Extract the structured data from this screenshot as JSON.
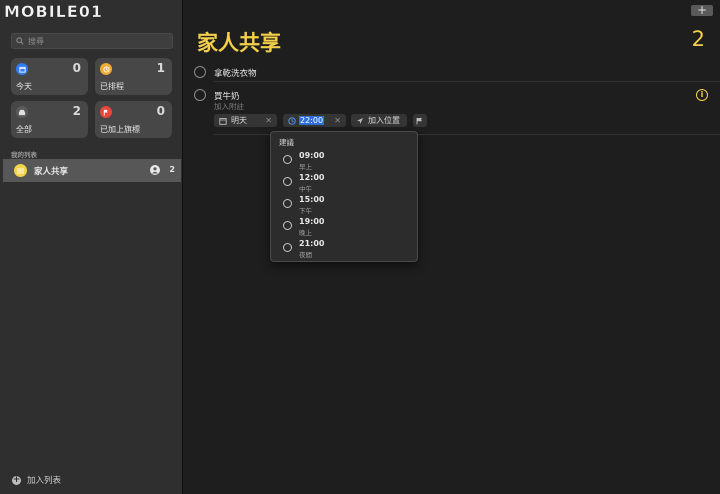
{
  "logo": "MOBILE01",
  "sidebar": {
    "search_placeholder": "搜尋",
    "tiles": [
      {
        "label": "今天",
        "count": "0",
        "color": "#2f7cf6",
        "icon": "calendar-icon"
      },
      {
        "label": "已排程",
        "count": "1",
        "color": "#f0a93a",
        "icon": "clock-icon"
      },
      {
        "label": "全部",
        "count": "2",
        "color": "#5a5a5a",
        "icon": "tray-icon"
      },
      {
        "label": "已加上旗標",
        "count": "0",
        "color": "#e8453c",
        "icon": "flag-icon"
      }
    ],
    "section_label": "我的列表",
    "lists": [
      {
        "name": "家人共享",
        "count": "2",
        "color": "#f2d34a"
      }
    ],
    "add_list_label": "加入列表"
  },
  "main": {
    "title": "家人共享",
    "count": "2",
    "add_button": "+",
    "tasks": [
      {
        "title": "拿乾洗衣物"
      },
      {
        "title": "買牛奶",
        "note_placeholder": "加入附註"
      }
    ],
    "chips": {
      "date": "明天",
      "time": "22:00",
      "location": "加入位置"
    }
  },
  "popup": {
    "header": "建議",
    "suggestions": [
      {
        "time": "09:00",
        "label": "早上"
      },
      {
        "time": "12:00",
        "label": "中午"
      },
      {
        "time": "15:00",
        "label": "下午"
      },
      {
        "time": "19:00",
        "label": "晚上"
      },
      {
        "time": "21:00",
        "label": "夜間"
      }
    ]
  }
}
